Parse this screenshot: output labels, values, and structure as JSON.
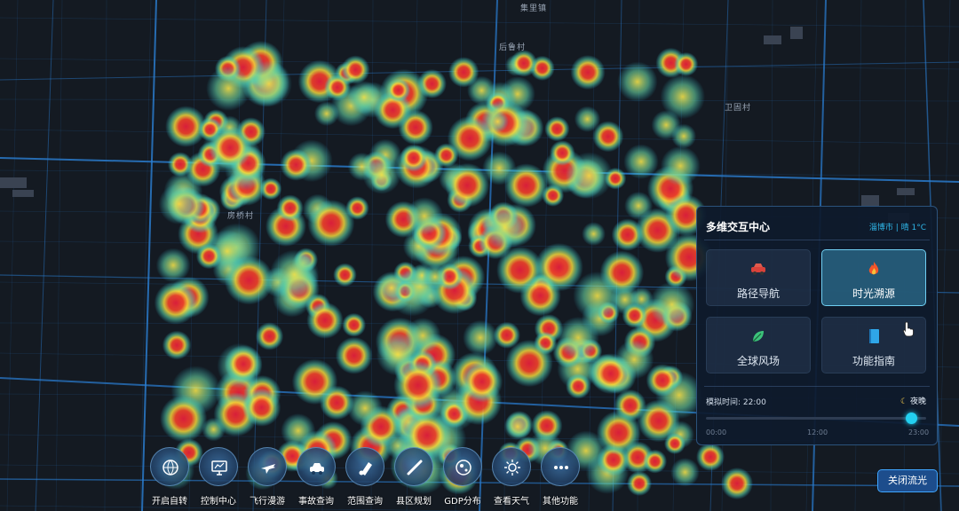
{
  "map": {
    "labels": {
      "town_top": "集里镇",
      "village_right": "卫固村",
      "village_top": "后鲁村",
      "village_left": "房桥村"
    }
  },
  "panel": {
    "title": "多维交互中心",
    "location_weather": "淄博市 | 晴 1°C",
    "tiles": [
      {
        "label": "路径导航",
        "icon": "car-icon",
        "active": false
      },
      {
        "label": "时光溯源",
        "icon": "flame-icon",
        "active": true
      },
      {
        "label": "全球风场",
        "icon": "leaf-icon",
        "active": false
      },
      {
        "label": "功能指南",
        "icon": "book-icon",
        "active": false
      }
    ],
    "sim_time_label": "模拟时间: 22:00",
    "mode_label": "夜晚",
    "slider_value_hour": 22,
    "ticks": [
      "00:00",
      "12:00",
      "23:00"
    ]
  },
  "toolbar": {
    "items": [
      {
        "label": "开启自转",
        "icon": "rotate-globe-icon"
      },
      {
        "label": "控制中心",
        "icon": "monitor-icon"
      },
      {
        "label": "飞行漫游",
        "icon": "plane-icon"
      },
      {
        "label": "事故查询",
        "icon": "car-accident-icon"
      },
      {
        "label": "范围查询",
        "icon": "range-icon"
      },
      {
        "label": "县区规划",
        "icon": "ruler-icon"
      },
      {
        "label": "GDP分布",
        "icon": "globe-icon"
      },
      {
        "label": "查看天气",
        "icon": "sun-icon"
      },
      {
        "label": "其他功能",
        "icon": "more-icon"
      }
    ]
  },
  "close_flow_label": "关闭流光",
  "colors": {
    "accent": "#23d0f0",
    "road": "#2a7fd4",
    "heat_high": "#d81e3a",
    "heat_mid": "#f2d63a",
    "heat_low": "#2fc4d8"
  }
}
